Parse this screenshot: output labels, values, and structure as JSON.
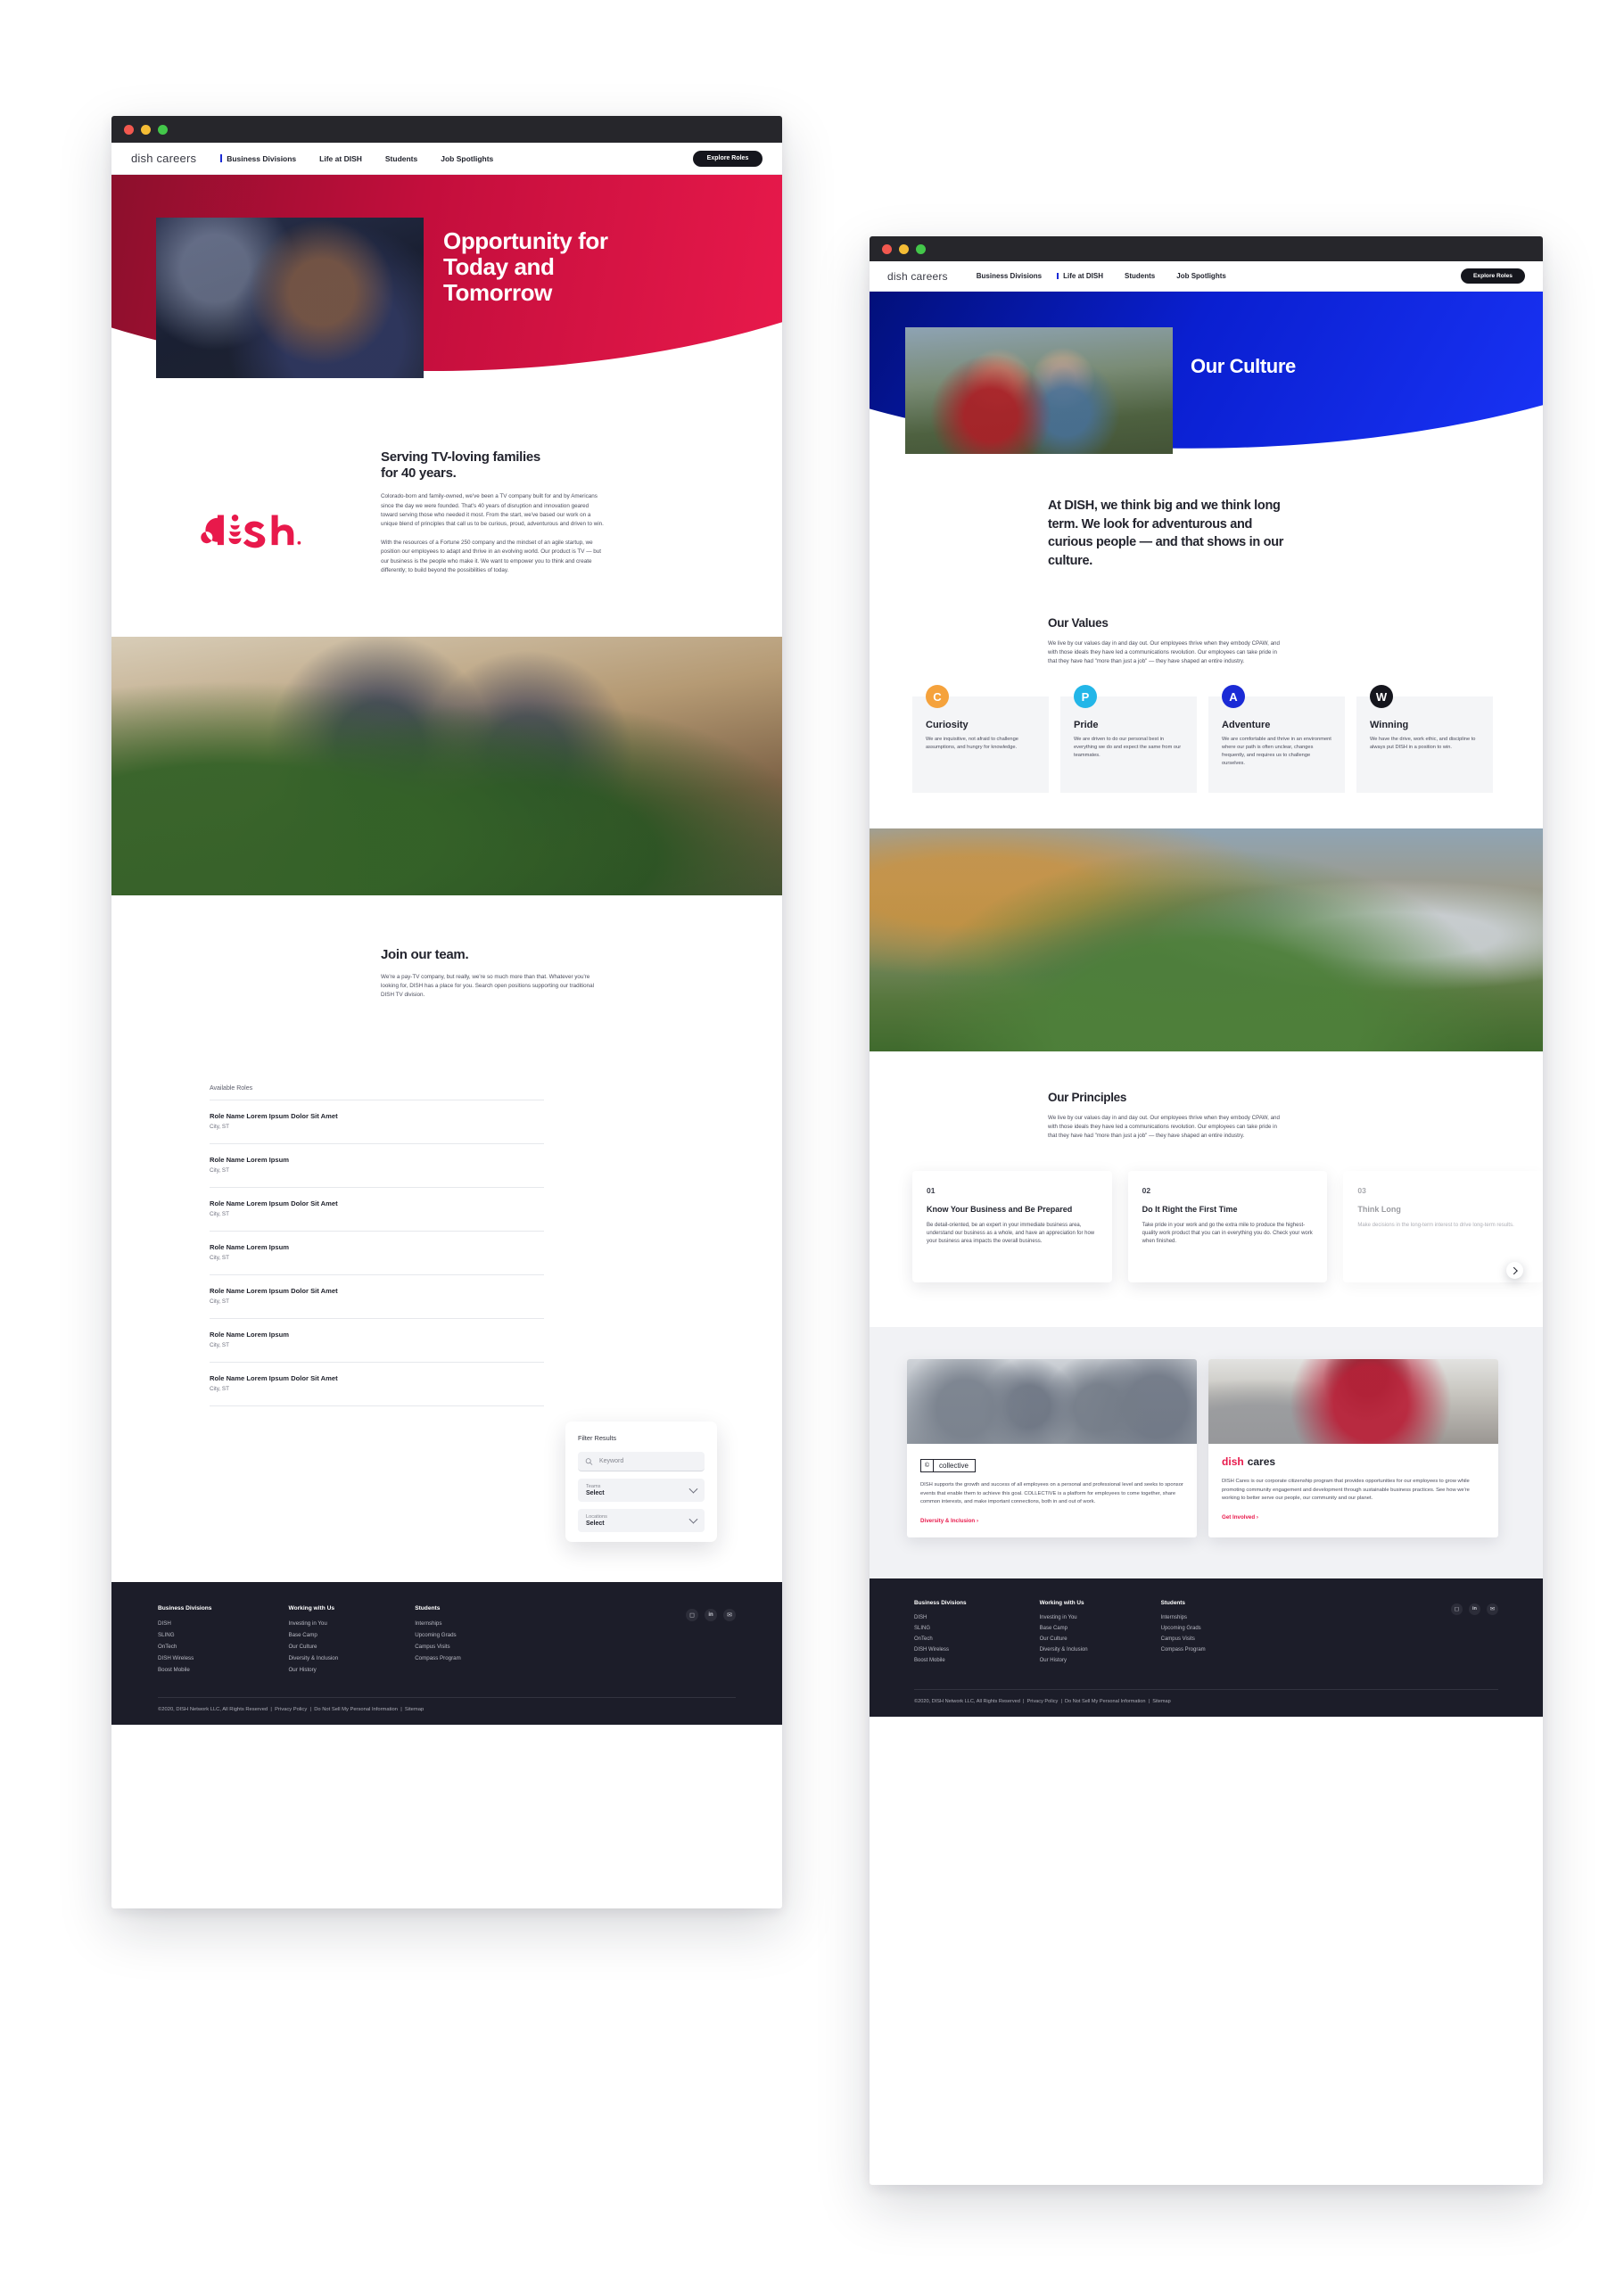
{
  "colors": {
    "dish_red": "#e8194b",
    "dish_blue": "#1933f5",
    "dark": "#1c1d29",
    "curiosity_orange": "#f5a23c",
    "pride_cyan": "#23b6e8",
    "adventure_blue": "#1b2bd6",
    "winning_black": "#15161d"
  },
  "window1": {
    "nav": {
      "brand": "dish careers",
      "links": [
        {
          "label": "Business Divisions",
          "active": true
        },
        {
          "label": "Life at DISH",
          "active": false
        },
        {
          "label": "Students",
          "active": false
        },
        {
          "label": "Job Spotlights",
          "active": false
        }
      ],
      "cta": "Explore Roles"
    },
    "hero": {
      "title_line1": "Opportunity for",
      "title_line2": "Today and",
      "title_line3": "Tomorrow",
      "image_alt": "dish-technician-photo"
    },
    "intro": {
      "logo_alt": "dish-logo",
      "heading_line1": "Serving TV-loving families",
      "heading_line2": "for 40 years.",
      "paragraph1": "Colorado-born and family-owned, we've been a TV company built for and by Americans since the day we were founded. That's 40 years of disruption and innovation geared toward serving those who needed it most. From the start, we've based our work on a unique blend of principles that call us to be curious, proud, adventurous and driven to win.",
      "paragraph2": "With the resources of a Fortune 250 company and the mindset of an agile startup, we position our employees to adapt and thrive in an evolving world. Our product is TV — but our business is the people who make it. We want to empower you to think and create differently; to build beyond the possibilities of today."
    },
    "midphoto_alt": "office-stairs-photo",
    "join": {
      "heading": "Join our team.",
      "paragraph": "We're a pay-TV company, but really, we're so much more than that. Whatever you're looking for, DISH has a place for you. Search open positions supporting our traditional DISH TV division.",
      "available_roles_label": "Available Roles",
      "roles": [
        {
          "title": "Role Name Lorem Ipsum Dolor Sit Amet",
          "location": "City, ST"
        },
        {
          "title": "Role Name Lorem Ipsum",
          "location": "City, ST"
        },
        {
          "title": "Role Name Lorem Ipsum Dolor Sit Amet",
          "location": "City, ST"
        },
        {
          "title": "Role Name Lorem Ipsum",
          "location": "City, ST"
        },
        {
          "title": "Role Name Lorem Ipsum Dolor Sit Amet",
          "location": "City, ST"
        },
        {
          "title": "Role Name Lorem Ipsum",
          "location": "City, ST"
        },
        {
          "title": "Role Name Lorem Ipsum Dolor Sit Amet",
          "location": "City, ST"
        }
      ],
      "filter": {
        "title": "Filter Results",
        "keyword_placeholder": "Keyword",
        "teams_label": "Teams",
        "teams_value": "Select",
        "locations_label": "Locations",
        "locations_value": "Select"
      }
    }
  },
  "window2": {
    "nav": {
      "brand": "dish careers",
      "links": [
        {
          "label": "Business Divisions",
          "active": false
        },
        {
          "label": "Life at DISH",
          "active": true
        },
        {
          "label": "Students",
          "active": false
        },
        {
          "label": "Job Spotlights",
          "active": false
        }
      ],
      "cta": "Explore Roles"
    },
    "hero": {
      "title": "Our Culture",
      "image_alt": "two-employees-outdoors-photo"
    },
    "lede": "At DISH, we think big and we think long term. We look for adventurous and curious people — and that shows in our culture.",
    "values": {
      "heading": "Our Values",
      "paragraph": "We live by our values day in and day out. Our employees thrive when they embody CPAW, and with those ideals they have led a communications revolution. Our employees can take pride in that they have had \"more than just a job\" — they have shaped an entire industry.",
      "cards": [
        {
          "badge": "C",
          "color": "#f5a23c",
          "name": "Curiosity",
          "desc": "We are inquisitive, not afraid to challenge assumptions, and hungry for knowledge."
        },
        {
          "badge": "P",
          "color": "#23b6e8",
          "name": "Pride",
          "desc": "We are driven to do our personal best in everything we do and expect the same from our teammates."
        },
        {
          "badge": "A",
          "color": "#1b2bd6",
          "name": "Adventure",
          "desc": "We are comfortable and thrive in an environment where our path is often unclear, changes frequently, and requires us to challenge ourselves."
        },
        {
          "badge": "W",
          "color": "#15161d",
          "name": "Winning",
          "desc": "We have the drive, work ethic, and discipline to always put DISH in a position to win."
        }
      ]
    },
    "bigphoto_alt": "campus-festival-photo",
    "principles": {
      "heading": "Our Principles",
      "paragraph": "We live by our values day in and day out. Our employees thrive when they embody CPAW, and with those ideals they have led a communications revolution. Our employees can take pride in that they have had \"more than just a job\" — they have shaped an entire industry.",
      "cards": [
        {
          "num": "01",
          "title": "Know Your Business and Be Prepared",
          "desc": "Be detail-oriented, be an expert in your immediate business area, understand our business as a whole, and have an appreciation for how your business area impacts the overall business."
        },
        {
          "num": "02",
          "title": "Do It Right the First Time",
          "desc": "Take pride in your work and go the extra mile to produce the highest-quality work product that you can in everything you do. Check your work when finished."
        },
        {
          "num": "03",
          "title": "Think Long",
          "desc": "Make decisions in the long-term interest to drive long-term results."
        }
      ]
    },
    "programs": [
      {
        "logo_type": "collective",
        "logo_text": "collective",
        "desc": "DISH supports the growth and success of all employees on a personal and professional level and seeks to sponsor events that enable them to achieve this goal. COLLECTIVE is a platform for employees to come together, share common interests, and make important connections, both in and out of work.",
        "link": "Diversity & Inclusion",
        "image_alt": "collective-team-photo"
      },
      {
        "logo_type": "dish-cares",
        "logo_text": "dish cares",
        "desc": "DISH Cares is our corporate citizenship program that provides opportunities for our employees to grow while promoting community engagement and development through sustainable business practices. See how we're working to better serve our people, our community and our planet.",
        "link": "Get Involved",
        "image_alt": "volunteer-kitchen-photo"
      }
    ]
  },
  "footer": {
    "columns": [
      {
        "head": "Business Divisions",
        "links": [
          "DISH",
          "SLING",
          "OnTech",
          "DISH Wireless",
          "Boost Mobile"
        ]
      },
      {
        "head": "Working with Us",
        "links": [
          "Investing in You",
          "Base Camp",
          "Our Culture",
          "Diversity & Inclusion",
          "Our History"
        ]
      },
      {
        "head": "Students",
        "links": [
          "Internships",
          "Upcoming Grads",
          "Campus Visits",
          "Compass Program"
        ]
      }
    ],
    "social": [
      "glassdoor-icon",
      "linkedin-icon",
      "email-icon"
    ],
    "copyright": "©2020, DISH Network LLC, All Rights Reserved",
    "legal_links": [
      "Privacy Policy",
      "Do Not Sell My Personal Information",
      "Sitemap"
    ]
  }
}
